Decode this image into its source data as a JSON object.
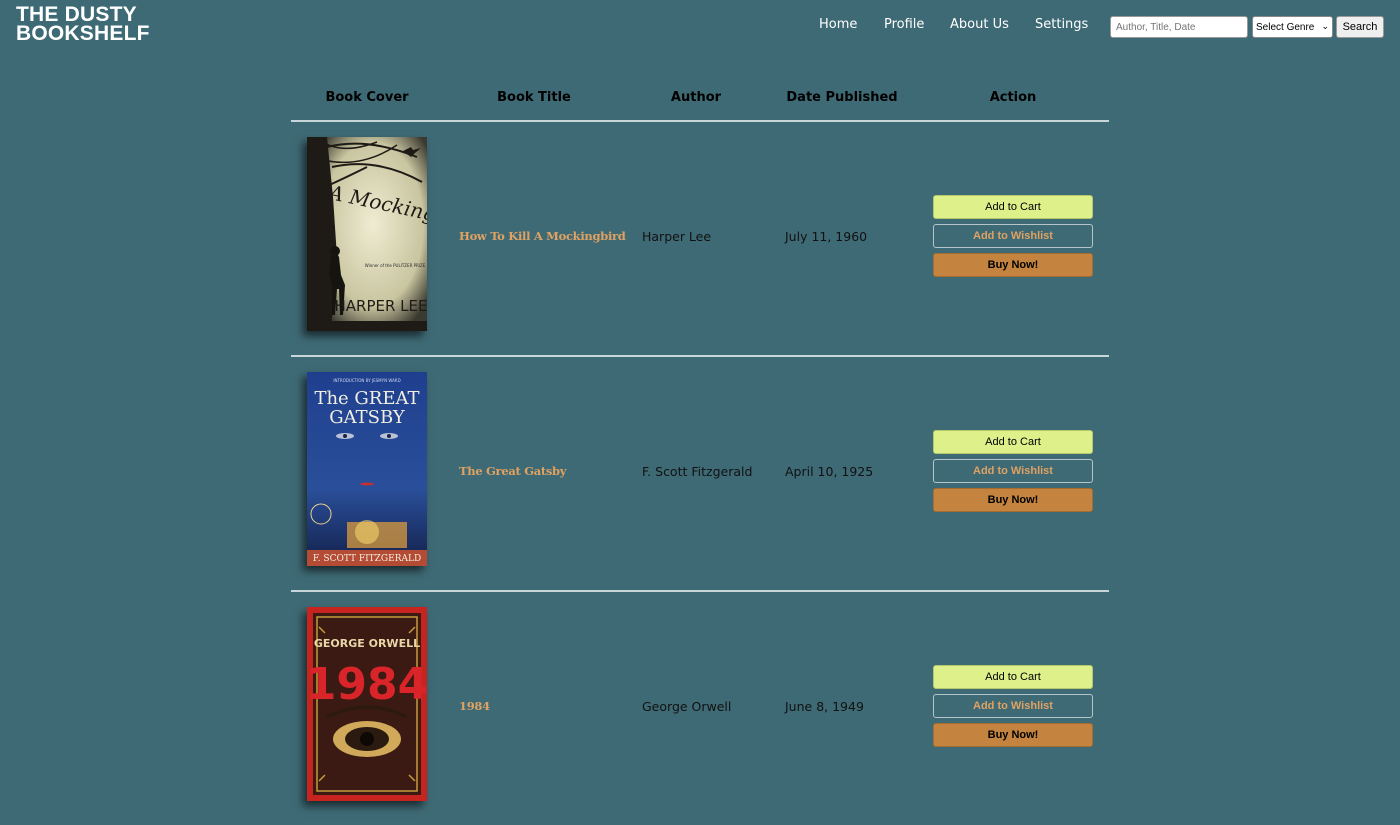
{
  "logo": {
    "line1": "THE DUSTY",
    "line2": "BOOKSHELF"
  },
  "nav": {
    "home": "Home",
    "profile": "Profile",
    "about": "About Us",
    "settings": "Settings"
  },
  "search": {
    "placeholder": "Author, Title, Date",
    "genre_selected": "Select Genre",
    "button": "Search"
  },
  "table": {
    "headers": {
      "cover": "Book Cover",
      "title": "Book Title",
      "author": "Author",
      "date": "Date Published",
      "action": "Action"
    },
    "rows": [
      {
        "title": "How To Kill A Mockingbird",
        "author": "Harper Lee",
        "date": "July 11, 1960",
        "cover": {
          "top_text": "To Kill A Mockingbird",
          "author_text": "HARPER LEE",
          "prize_text": "Winner of the PULITZER PRIZE"
        }
      },
      {
        "title": "The Great Gatsby",
        "author": "F. Scott Fitzgerald",
        "date": "April 10, 1925",
        "cover": {
          "intro_text": "INTRODUCTION BY JESMYN WARD",
          "title_line1": "The GREAT",
          "title_line2": "GATSBY",
          "author_text": "F. SCOTT FITZGERALD"
        }
      },
      {
        "title": "1984",
        "author": "George Orwell",
        "date": "June 8, 1949",
        "cover": {
          "author_text": "GEORGE ORWELL",
          "title_text": "1984"
        }
      }
    ],
    "buttons": {
      "cart": "Add to Cart",
      "wishlist": "Add to Wishlist",
      "buy": "Buy Now!"
    }
  },
  "colors": {
    "background": "#3e6a75",
    "title_link": "#e0a262",
    "cart_button": "#def08a",
    "buy_button": "#c4843f",
    "divider": "#c7d6d9"
  }
}
